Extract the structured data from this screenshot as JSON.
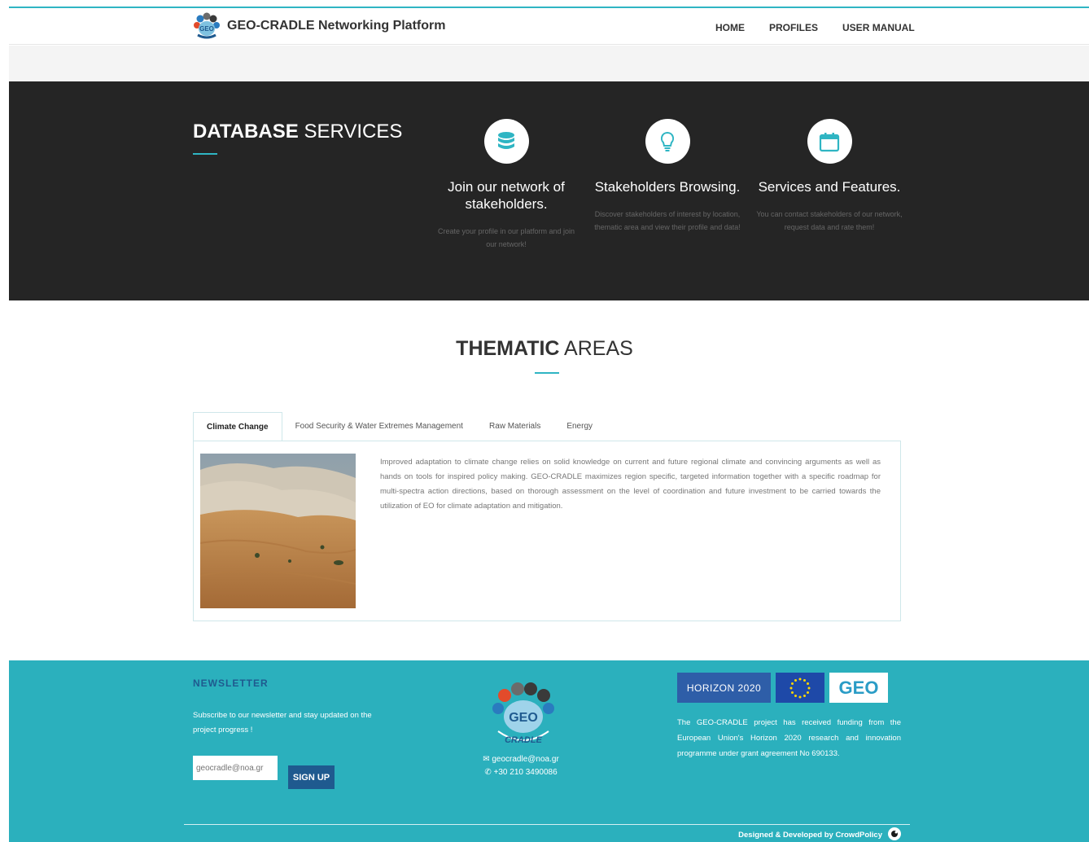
{
  "nav": {
    "brand_title": "GEO-CRADLE Networking Platform",
    "items": [
      {
        "label": "HOME",
        "active": true
      },
      {
        "label": "PROFILES"
      },
      {
        "label": "USER MANUAL"
      }
    ]
  },
  "database": {
    "title_bold": "DATABASE",
    "title_light": "SERVICES",
    "features": [
      {
        "icon": "database-icon",
        "title": "Join our network of stakeholders.",
        "text": "Create your profile in our platform and join our network!"
      },
      {
        "icon": "lightbulb-icon",
        "title": "Stakeholders Browsing.",
        "text": "Discover stakeholders of interest by location, thematic area and view their profile and data!"
      },
      {
        "icon": "calendar-icon",
        "title": "Services and Features.",
        "text": "You can contact stakeholders of our network, request data and rate them!"
      }
    ]
  },
  "thematic": {
    "title_bold": "THEMATIC",
    "title_light": "AREAS",
    "tabs": [
      {
        "label": "Climate Change",
        "active": true
      },
      {
        "label": "Food Security & Water Extremes Management"
      },
      {
        "label": "Raw Materials"
      },
      {
        "label": "Energy"
      }
    ],
    "panel_text": "Improved adaptation to climate change relies on solid knowledge on current and future regional climate and convincing arguments as well as hands on tools for inspired policy making. GEO-CRADLE maximizes region specific, targeted information together with a specific roadmap for multi-spectra action directions, based on thorough assessment on the level of coordination and future investment to be carried towards the utilization of EO for climate adaptation and mitigation."
  },
  "footer": {
    "newsletter_title": "NEWSLETTER",
    "newsletter_text": "Subscribe to our newsletter and stay updated on the project progress !",
    "email_placeholder": "geocradle@noa.gr",
    "signup_label": "SIGN UP",
    "logo_text": "CRADLE",
    "email": "geocradle@noa.gr",
    "phone": "+30 210 3490086",
    "horizon_label": "HORIZON 2020",
    "geo_label": "GEO",
    "funding_text": "The GEO-CRADLE project has received funding from the European Union's Horizon 2020 research and innovation programme under grant agreement No 690133.",
    "credit": "Designed & Developed by CrowdPolicy"
  },
  "colors": {
    "accent": "#2fb5c3",
    "dark_band": "#252525",
    "footer_bg": "#2bb0bd",
    "button_blue": "#1f5a8f"
  }
}
